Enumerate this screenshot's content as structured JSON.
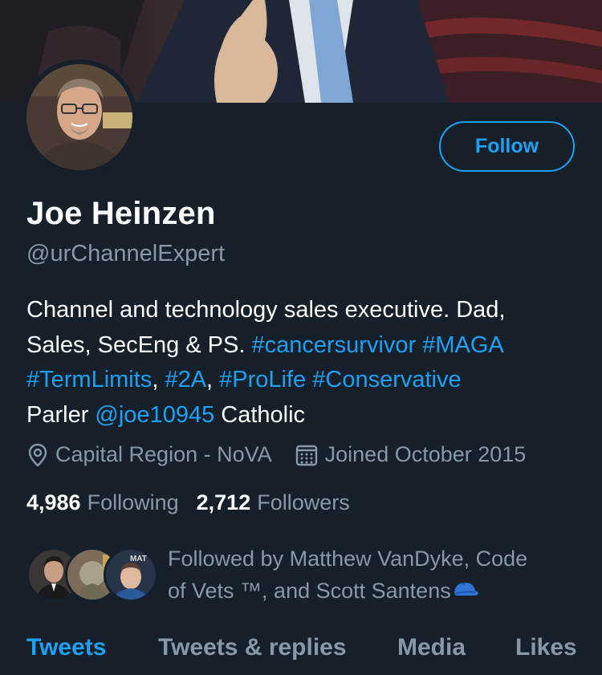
{
  "profile": {
    "name": "Joe Heinzen",
    "handle": "@urChannelExpert",
    "follow_label": "Follow",
    "bio": {
      "line1": "Channel and technology sales executive. Dad,",
      "line2_text": "Sales, SecEng & PS. ",
      "line2_tag1": "#cancersurvivor",
      "line2_tag2": "#MAGA",
      "line3_tag1": "#TermLimits",
      "line3_tag2": "#2A",
      "line3_tag3": "#ProLife",
      "line3_tag4": "#Conservative",
      "line4_text1": "Parler ",
      "line4_mention": "@joe10945",
      "line4_text2": " Catholic"
    },
    "location": "Capital Region - NoVA",
    "joined": "Joined October 2015",
    "following_count": "4,986",
    "following_label": "Following",
    "followers_count": "2,712",
    "followers_label": "Followers",
    "followed_by_line1": "Followed by Matthew VanDyke, Code",
    "followed_by_line2": "of Vets ™, and Scott Santens",
    "icons": {
      "location": "location-pin-icon",
      "calendar": "calendar-icon",
      "cap": "blue-cap-emoji"
    },
    "colors": {
      "accent": "#1da1f2",
      "background": "#15202b",
      "secondary_text": "#8899a6"
    }
  },
  "tabs": [
    {
      "label": "Tweets",
      "active": true
    },
    {
      "label": "Tweets & replies",
      "active": false
    },
    {
      "label": "Media",
      "active": false
    },
    {
      "label": "Likes",
      "active": false
    }
  ]
}
